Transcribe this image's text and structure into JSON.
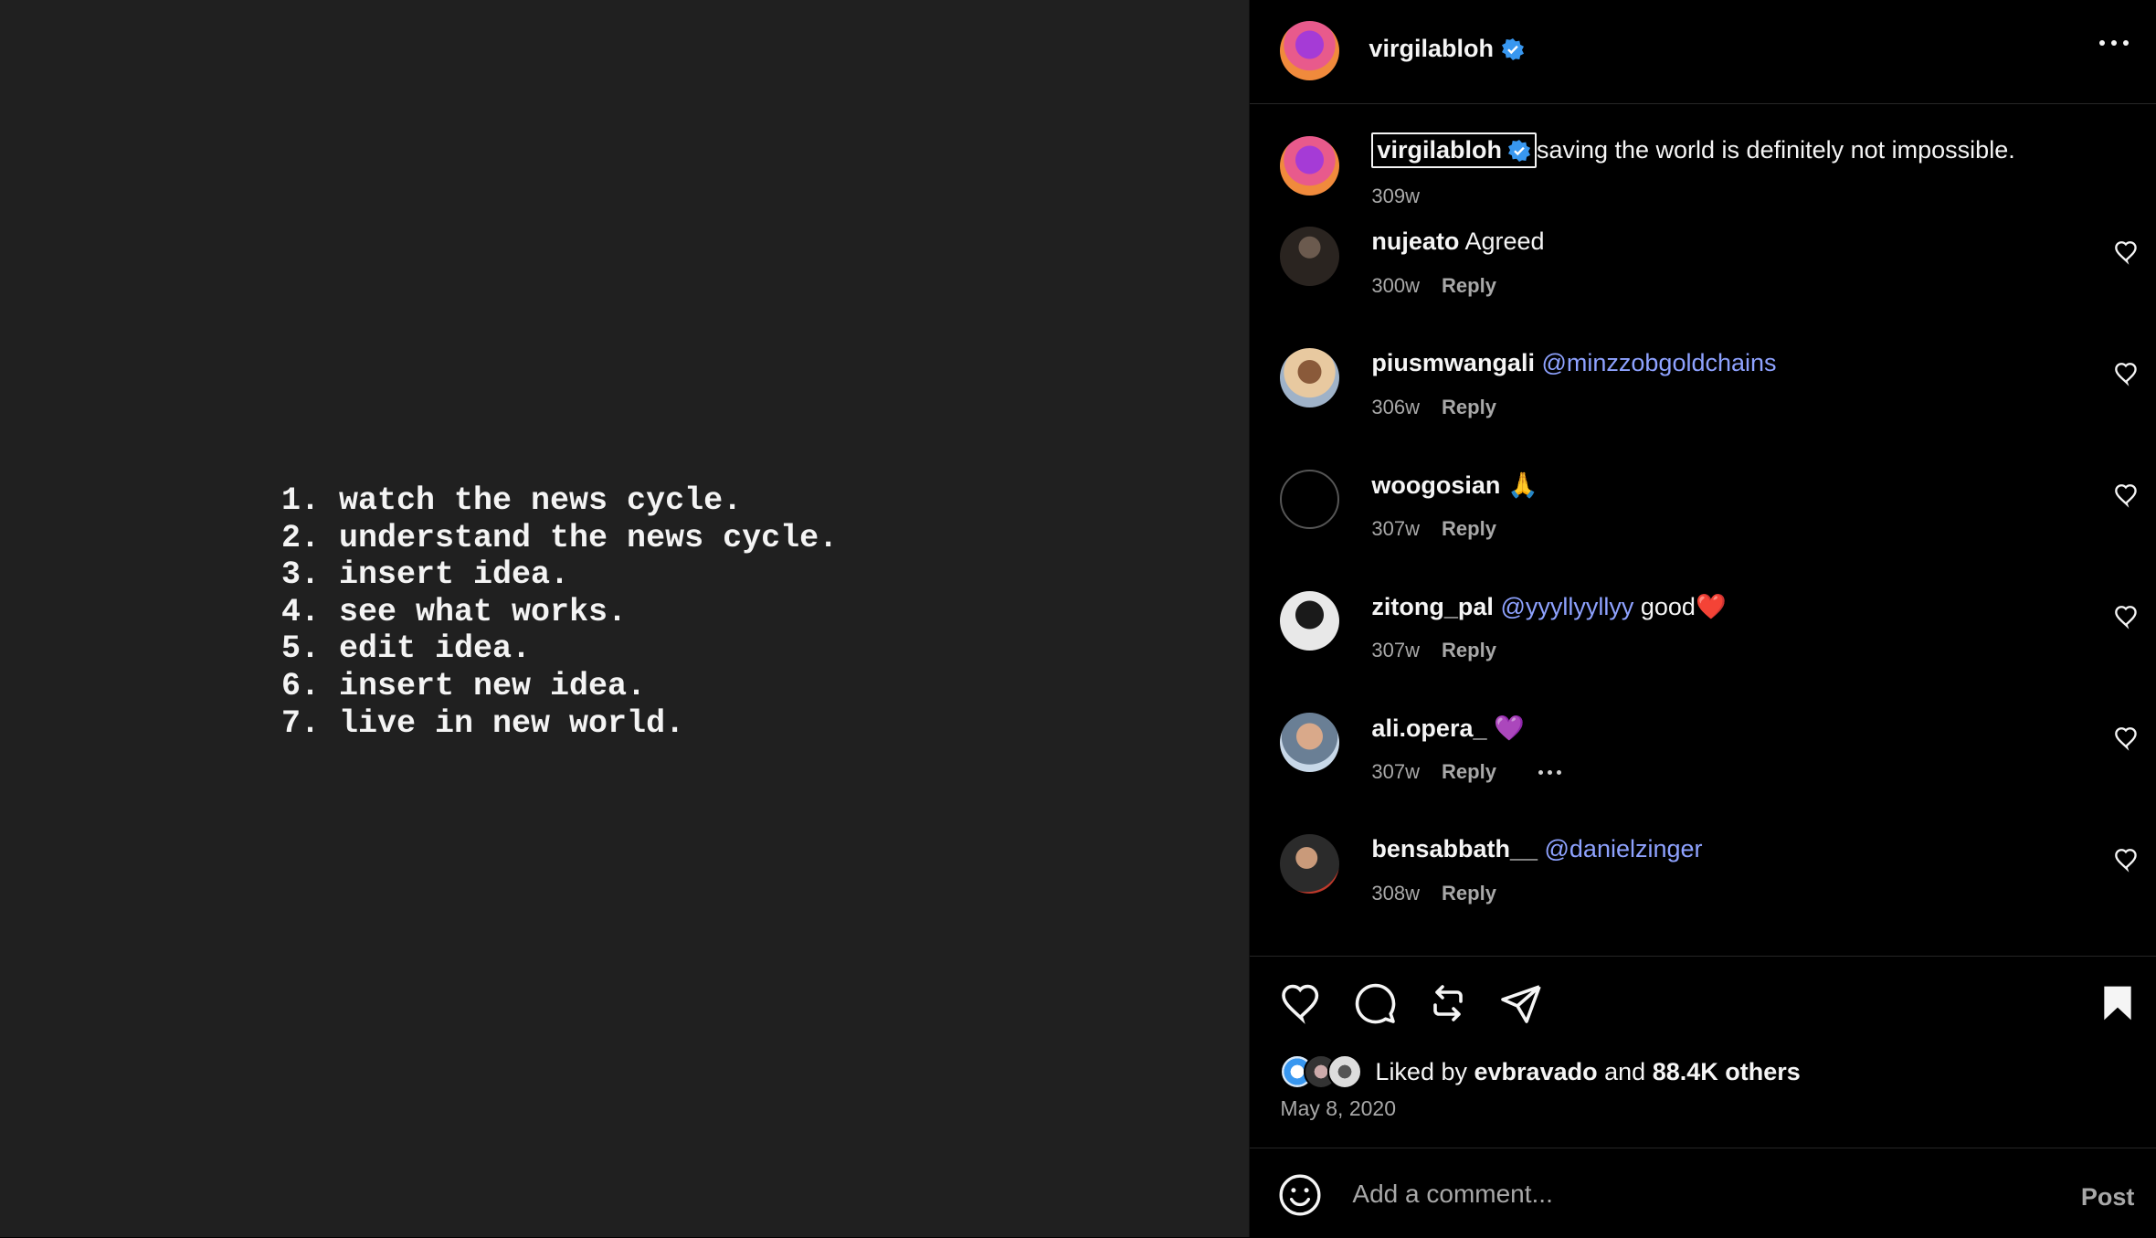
{
  "post_media": {
    "lines": [
      "1. watch the news cycle.",
      "2. understand the news cycle.",
      "3. insert idea.",
      "4. see what works.",
      "5. edit idea.",
      "6. insert new idea.",
      "7. live in new world."
    ]
  },
  "header": {
    "username": "virgilabloh",
    "verified": true
  },
  "caption": {
    "username": "virgilabloh",
    "text": "saving the world is definitely not impossible.",
    "time": "309w"
  },
  "comments": [
    {
      "username": "nujeato",
      "text": "Agreed",
      "mention": "",
      "emoji": "",
      "time": "300w",
      "reply": "Reply"
    },
    {
      "username": "piusmwangali",
      "text": "",
      "mention": "@minzzobgoldchains",
      "emoji": "",
      "time": "306w",
      "reply": "Reply"
    },
    {
      "username": "woogosian",
      "text": "",
      "mention": "",
      "emoji": "🙏",
      "time": "307w",
      "reply": "Reply"
    },
    {
      "username": "zitong_pal",
      "text": "good",
      "mention": "@yyyllyyllyy",
      "emoji": "❤️",
      "time": "307w",
      "reply": "Reply"
    },
    {
      "username": "ali.opera_",
      "text": "",
      "mention": "",
      "emoji": "💜",
      "time": "307w",
      "reply": "Reply"
    },
    {
      "username": "bensabbath__",
      "text": "",
      "mention": "@danielzinger",
      "emoji": "",
      "time": "308w",
      "reply": "Reply"
    }
  ],
  "likes": {
    "prefix": "Liked by",
    "user": "evbravado",
    "joiner": "and",
    "others": "88.4K others"
  },
  "date": "May 8, 2020",
  "comment_box": {
    "placeholder": "Add a comment...",
    "post_label": "Post"
  },
  "colors": {
    "background": "#000000",
    "media_bg": "#202020",
    "mention": "#8ea2ff",
    "verified": "#3897f0",
    "muted": "#a8a8a8"
  }
}
